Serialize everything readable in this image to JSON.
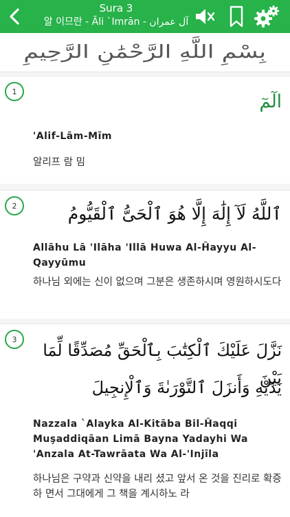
{
  "header": {
    "sura_label": "Sura 3",
    "sura_names": "알 이므란 - Āli `Imrān - آل عمران",
    "colors": {
      "bar": "#27b24a",
      "icon": "#ffffff"
    },
    "icons": [
      "chevron-left-icon",
      "speaker-mute-icon",
      "bookmark-icon",
      "gear-icon"
    ]
  },
  "bismillah": "بِسْمِ اللَّهِ الرَّحْمَٰنِ الرَّحِيمِ",
  "verses": [
    {
      "number": "1",
      "arabic": "الٓمٓ",
      "translit": "'Alif-Lām-Mīm",
      "korean": "알리프 람 밈"
    },
    {
      "number": "2",
      "arabic": "ٱللَّهُ لَآ إِلَٰهَ إِلَّا هُوَ ٱلْحَىُّ ٱلْقَيُّومُ",
      "translit": "Allāhu Lā 'Ilāha 'Illā Huwa Al-Ĥayyu Al-Qayyūmu",
      "korean": "하나님 외에는 신이 없으며 그분은 생존하시며 영원하시도다"
    },
    {
      "number": "3",
      "arabic_line1": "نَزَّلَ عَلَيْكَ ٱلْكِتَٰبَ بِٱلْحَقِّ مُصَدِّقًا لِّمَا بَيْنَ",
      "arabic_line2": "يَدَيْهِ وَأَنزَلَ ٱلتَّوْرَىٰةَ وَٱلْإِنجِيلَ",
      "translit": "Nazzala `Alayka Al-Kitāba Bil-Ĥaqqi Muşaddiqāan Limā Bayna Yadayhi Wa 'Anzala At-Tawrāata Wa Al-'Injīla",
      "korean": "하나님은 구약과 신약을 내리 셨고 앞서 온 것을 진리로 확증하 면서 그대에게 그 책을 계시하노 라"
    }
  ]
}
